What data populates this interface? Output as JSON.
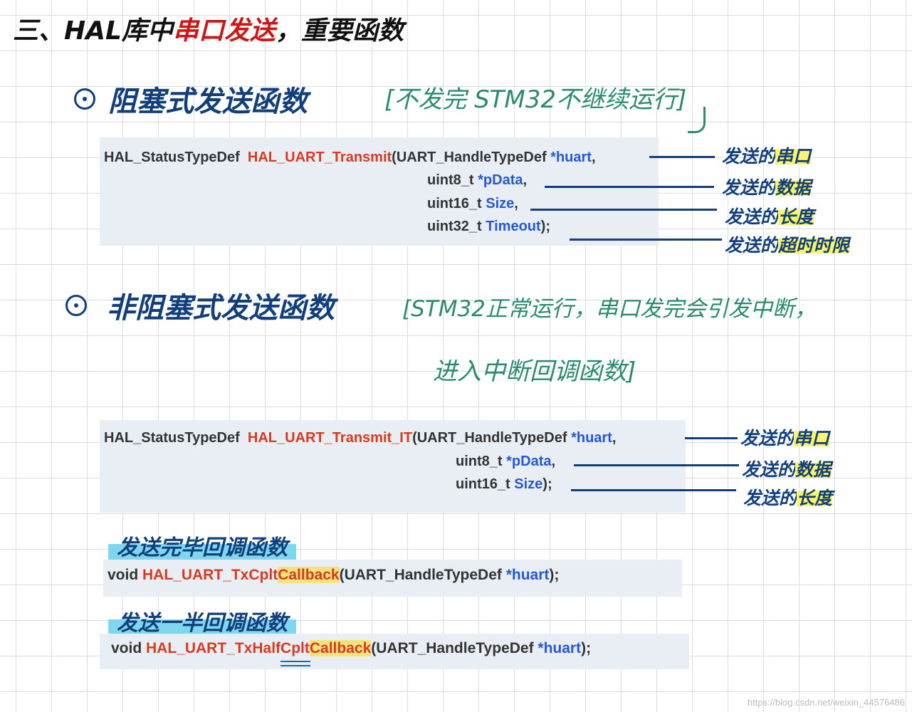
{
  "title": {
    "prefix": "三、HAL库中",
    "highlight": "串口发送",
    "suffix": "，重要函数"
  },
  "section1": {
    "heading": "阻塞式发送函数",
    "note": "[不发完 STM32不继续运行]",
    "code": {
      "ret_type": "HAL_StatusTypeDef",
      "func": "HAL_UART_Transmit",
      "p1_type": "(UART_HandleTypeDef ",
      "p1_name": "*huart",
      "p2_type": "uint8_t ",
      "p2_name": "*pData",
      "p3_type": "uint16_t ",
      "p3_name": "Size",
      "p4_type": "uint32_t ",
      "p4_name": "Timeout"
    },
    "annotations": [
      {
        "pre": "发送的",
        "hl": "串口"
      },
      {
        "pre": "发送的",
        "hl": "数据"
      },
      {
        "pre": "发送的",
        "hl": "长度"
      },
      {
        "pre": "发送的",
        "hl": "超时时限"
      }
    ]
  },
  "section2": {
    "heading": "非阻塞式发送函数",
    "note_line1": "[STM32正常运行，串口发完会引发中断，",
    "note_line2": "进入中断回调函数]",
    "code": {
      "ret_type": "HAL_StatusTypeDef",
      "func": "HAL_UART_Transmit_IT",
      "p1_type": "(UART_HandleTypeDef ",
      "p1_name": "*huart",
      "p2_type": "uint8_t ",
      "p2_name": "*pData",
      "p3_type": "uint16_t ",
      "p3_name": "Size"
    },
    "annotations": [
      {
        "pre": "发送的",
        "hl": "串口"
      },
      {
        "pre": "发送的",
        "hl": "数据"
      },
      {
        "pre": "发送的",
        "hl": "长度"
      }
    ]
  },
  "callbacks": [
    {
      "label": "发送完毕回调函数",
      "void": "void ",
      "func_a": "HAL_UART_TxCplt",
      "func_b": "Callback",
      "params": "(UART_HandleTypeDef  ",
      "param_name": "*huart",
      "tail": ");"
    },
    {
      "label": "发送一半回调函数",
      "void": "void ",
      "func_a": "HAL_UART_Tx",
      "func_b": "HalfCplt",
      "func_c": "Callback",
      "params": "(UART_HandleTypeDef  ",
      "param_name": "*huart",
      "tail": ");"
    }
  ],
  "watermark": "https://blog.csdn.net/weixin_44576486",
  "colors": {
    "navy": "#123f7c",
    "teal": "#2b8a72",
    "red": "#d81e1e",
    "code_fn": "#d83a1f",
    "code_kw": "#2458d6",
    "yellow_hl": "#fbf56a",
    "cyan_hl": "#7fd7ef"
  }
}
